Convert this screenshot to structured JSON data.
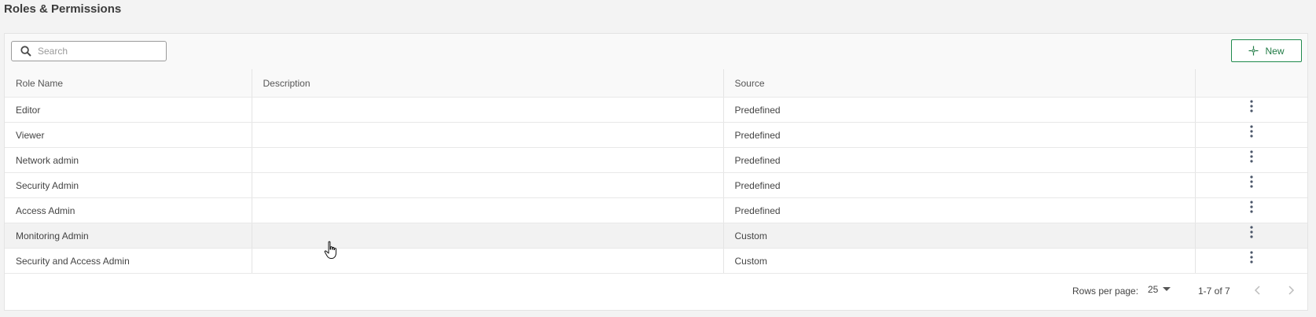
{
  "page": {
    "title": "Roles & Permissions"
  },
  "toolbar": {
    "search_placeholder": "Search",
    "new_label": "New",
    "new_icon": "add-sparkle-icon",
    "accent_color": "#1f8a4c"
  },
  "table": {
    "columns": [
      "Role Name",
      "Description",
      "Source",
      ""
    ],
    "rows": [
      {
        "name": "Editor",
        "description": "",
        "source": "Predefined"
      },
      {
        "name": "Viewer",
        "description": "",
        "source": "Predefined"
      },
      {
        "name": "Network admin",
        "description": "",
        "source": "Predefined"
      },
      {
        "name": "Security Admin",
        "description": "",
        "source": "Predefined"
      },
      {
        "name": "Access Admin",
        "description": "",
        "source": "Predefined"
      },
      {
        "name": "Monitoring Admin",
        "description": "",
        "source": "Custom"
      },
      {
        "name": "Security and Access Admin",
        "description": "",
        "source": "Custom"
      }
    ],
    "row_action_icon": "more-vertical-icon"
  },
  "pagination": {
    "rows_per_page_label": "Rows per page:",
    "rows_per_page_value": "25",
    "range": "1-7 of 7"
  }
}
